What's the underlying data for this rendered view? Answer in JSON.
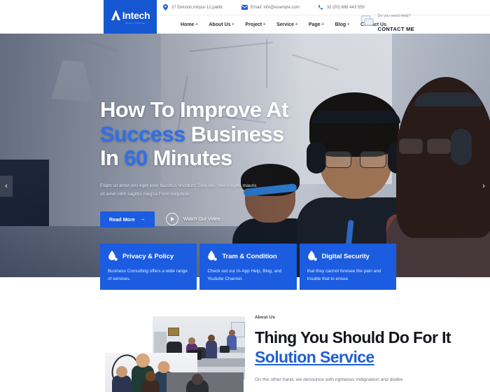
{
  "header": {
    "logo": {
      "name": "Intech",
      "tagline": "Solution Technology"
    },
    "topbar": [
      {
        "icon": "location-pin-icon",
        "text": "27 Division,mirpur-12,pallbi."
      },
      {
        "icon": "mail-icon",
        "text": "Email: info@example.com"
      },
      {
        "icon": "phone-icon",
        "text": "32 (00) 888 443 555"
      }
    ],
    "nav": [
      {
        "label": "Home",
        "caret": "+"
      },
      {
        "label": "About Us",
        "caret": "+"
      },
      {
        "label": "Project",
        "caret": "+"
      },
      {
        "label": "Service",
        "caret": "+"
      },
      {
        "label": "Page",
        "caret": "+"
      },
      {
        "label": "Blog",
        "caret": "+"
      },
      {
        "label": "Contact Us",
        "caret": ""
      }
    ],
    "contact": {
      "icon": "chat-bubble-icon",
      "question": "Do you need Help?",
      "action": "CONTACT ME"
    }
  },
  "hero": {
    "heading_line1": "How To Improve At",
    "heading_line2_accent": "Success",
    "heading_line2_rest": " Business",
    "heading_line3_pre": "In ",
    "heading_line3_accent": "60",
    "heading_line3_rest": " Minutes",
    "paragraph": "Etiam sit amet orci eget eros faucibus tincidunt. Duis leo. Sed fringilla mauris sit amet nibh.sagittis magna.From helpdesk.",
    "read_more": "Read More",
    "read_more_arrow": "→",
    "watch_video": "Watch Our Video",
    "prev_arrow": "‹",
    "next_arrow": "›"
  },
  "cards": [
    {
      "icon": "water-drop-icon",
      "title": "Privacy & Policy",
      "text": "Business Consulting offers a wide range of services."
    },
    {
      "icon": "water-drop-icon",
      "title": "Tram & Condition",
      "text": "Check out our In-App Help, Blog, and Youtube Channel."
    },
    {
      "icon": "water-drop-icon",
      "title": "Digital Security",
      "text": "that they cannot foresee the pain and trouble that to ensue."
    }
  ],
  "about": {
    "label": "About Us",
    "heading_pre": "Thing You Should Do For It ",
    "heading_link": "Solution Service",
    "paragraph": "On the other hand, we denounce with righteous indignation and dislike"
  },
  "colors": {
    "brand_blue": "#1b5ce0",
    "logo_blue": "#1557d0",
    "accent_blue": "#2f6fe8",
    "link_blue": "#1f5fd8",
    "dark_text": "#14161d",
    "muted_text": "#6d727d"
  }
}
